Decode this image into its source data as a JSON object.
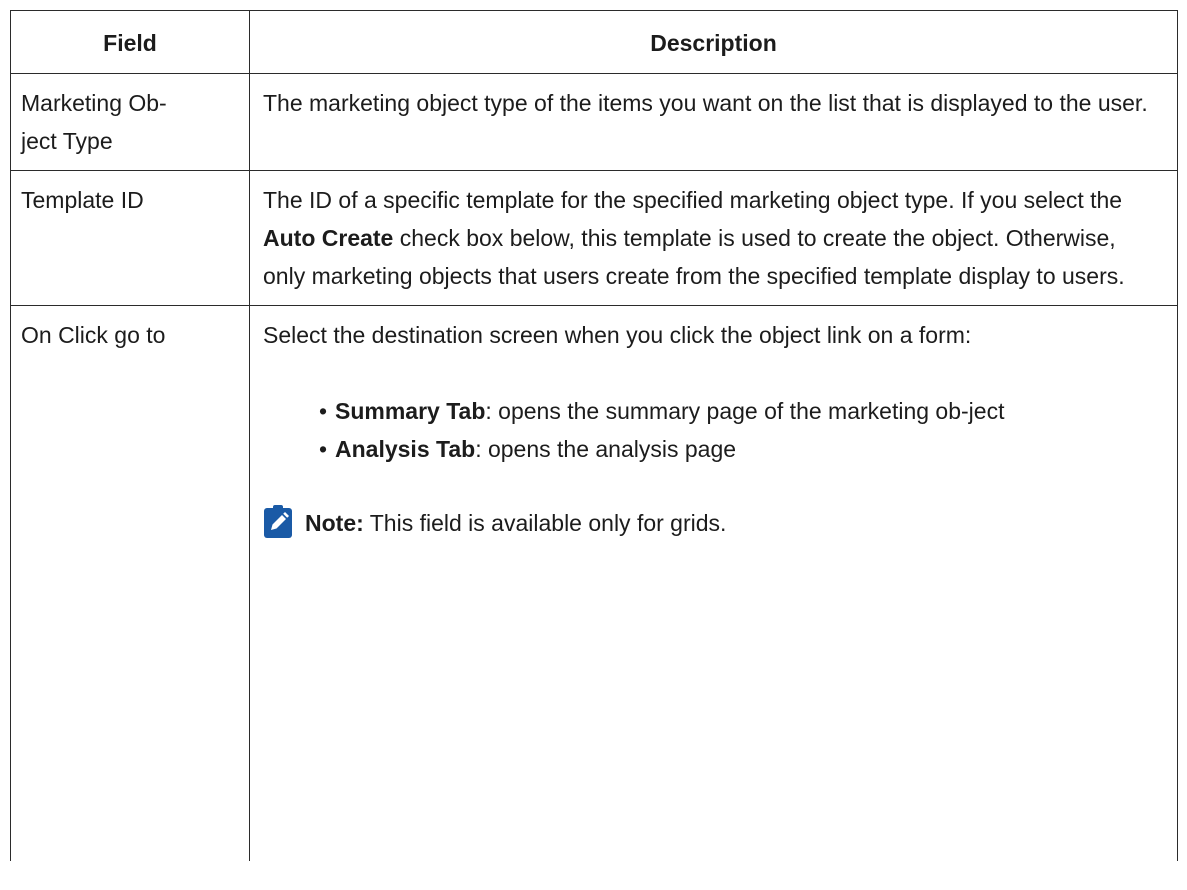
{
  "table": {
    "headers": {
      "field": "Field",
      "description": "Description"
    },
    "rows": [
      {
        "field": "Marketing Ob-ject Type",
        "field_line1": "Marketing Ob-",
        "field_line2": "ject Type",
        "description": "The marketing object type of the items you want on the list that is displayed to the user."
      },
      {
        "field": "Template ID",
        "description_part1": "The ID of a specific template for the specified marketing object type. If you select the ",
        "description_bold": "Auto Create",
        "description_part2": " check box below, this template is used to create the object. Otherwise, only marketing objects that users create from the specified template display to users."
      },
      {
        "field": "On Click go to",
        "description_intro": "Select the destination screen when you click the object link on a form:",
        "options": [
          {
            "label": "Summary Tab",
            "text": ": opens the summary page of the marketing ob-ject"
          },
          {
            "label": "Analysis Tab",
            "text": ": opens the analysis page"
          }
        ],
        "note": {
          "label": "Note:",
          "text": " This field is available only for grids.",
          "icon": "pencil-note-icon",
          "icon_color": "#1a5aa6"
        }
      }
    ]
  }
}
